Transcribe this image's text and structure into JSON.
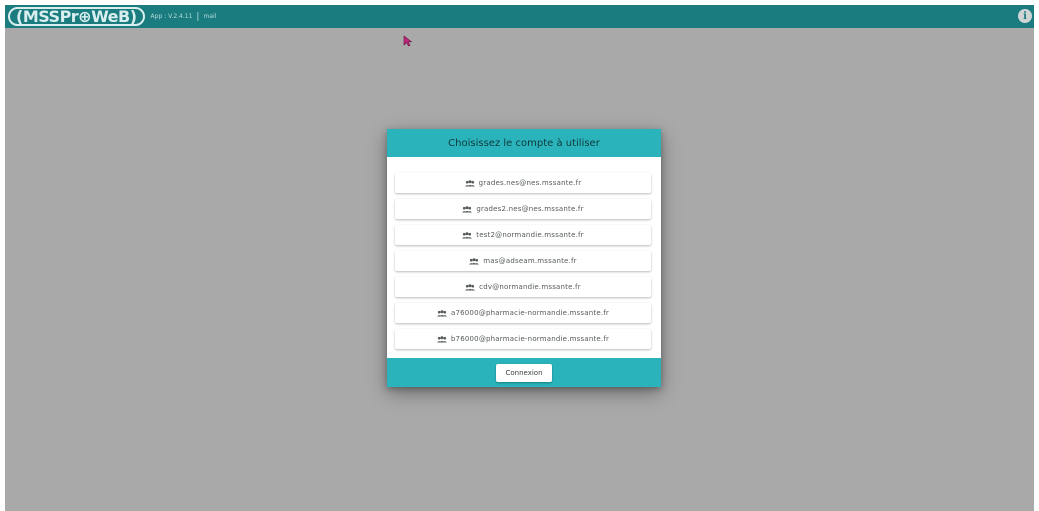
{
  "header": {
    "logo_text": "(MSSPr⊕WeB)",
    "version": "App : V.2.4.11",
    "separator": "|",
    "mode": "mail",
    "info_label": "i",
    "bg_color": "#1a7c7f"
  },
  "dialog": {
    "title": "Choisissez le compte à utiliser",
    "accent_color": "#2ab3bb",
    "accounts": [
      {
        "label": "grades.nes@nes.mssante.fr",
        "icon": "group-icon"
      },
      {
        "label": "grades2.nes@nes.mssante.fr",
        "icon": "group-icon"
      },
      {
        "label": "test2@normandie.mssante.fr",
        "icon": "group-icon"
      },
      {
        "label": "mas@adseam.mssante.fr",
        "icon": "group-icon"
      },
      {
        "label": "cdv@normandie.mssante.fr",
        "icon": "group-icon"
      },
      {
        "label": "a76000@pharmacie-normandie.mssante.fr",
        "icon": "group-icon"
      },
      {
        "label": "b76000@pharmacie-normandie.mssante.fr",
        "icon": "group-icon"
      }
    ],
    "connect_label": "Connexion"
  }
}
